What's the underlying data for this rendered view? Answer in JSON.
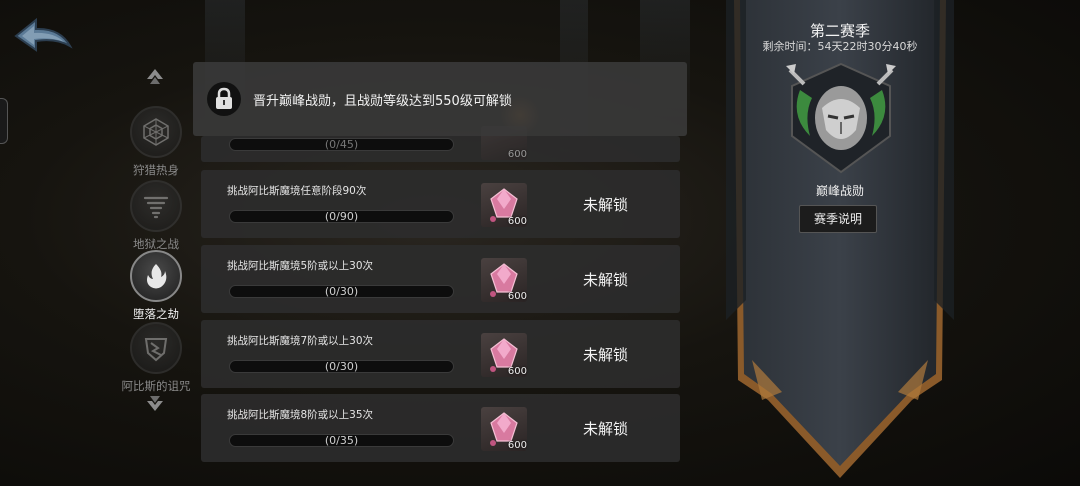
{
  "lock_banner": {
    "text": "晋升巅峰战勋，且战勋等级达到550级可解锁"
  },
  "nav": {
    "items": [
      {
        "label": "狩猎热身",
        "icon": "web-hex-icon",
        "active": false
      },
      {
        "label": "地狱之战",
        "icon": "tornado-icon",
        "active": false
      },
      {
        "label": "堕落之劫",
        "icon": "flame-icon",
        "active": true
      },
      {
        "label": "阿比斯的诅咒",
        "icon": "broken-shield-icon",
        "active": false
      }
    ]
  },
  "tasks": [
    {
      "title": "",
      "progress": "(0/45)",
      "progress_fraction": 0,
      "reward_amount": "600",
      "status": ""
    },
    {
      "title": "挑战阿比斯魔境任意阶段90次",
      "progress": "(0/90)",
      "progress_fraction": 0,
      "reward_amount": "600",
      "status": "未解锁"
    },
    {
      "title": "挑战阿比斯魔境5阶或以上30次",
      "progress": "(0/30)",
      "progress_fraction": 0,
      "reward_amount": "600",
      "status": "未解锁"
    },
    {
      "title": "挑战阿比斯魔境7阶或以上30次",
      "progress": "(0/30)",
      "progress_fraction": 0,
      "reward_amount": "600",
      "status": "未解锁"
    },
    {
      "title": "挑战阿比斯魔境8阶或以上35次",
      "progress": "(0/35)",
      "progress_fraction": 0,
      "reward_amount": "600",
      "status": "未解锁"
    }
  ],
  "season": {
    "title": "第二赛季",
    "time_remaining": "剩余时间：54天22时30分40秒",
    "rank_name": "巅峰战勋",
    "info_button": "赛季说明"
  },
  "colors": {
    "banner_dark": "#23272c",
    "banner_trim": "#b07a3c",
    "reward_gem": "#e07aa0"
  }
}
